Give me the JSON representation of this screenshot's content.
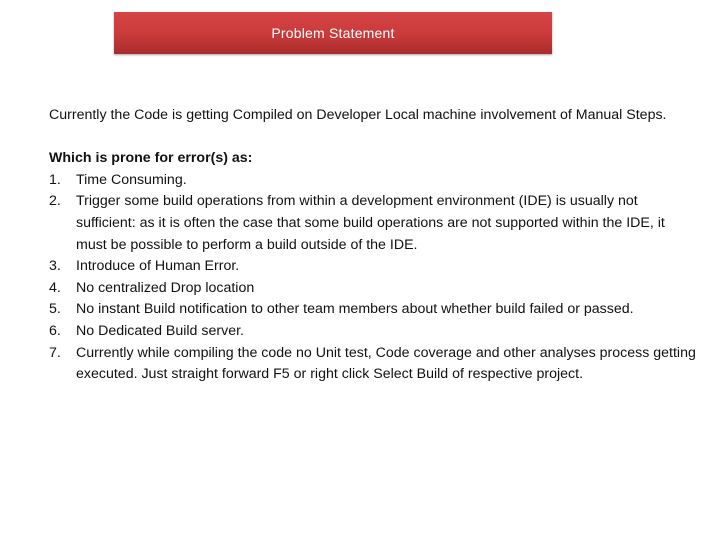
{
  "header": {
    "title": "Problem Statement",
    "color": "#c93a3a"
  },
  "intro": "Currently the Code is getting Compiled on Developer Local machine involvement of Manual Steps.",
  "list_heading": "Which is prone for error(s) as:",
  "items": [
    {
      "num": "1.",
      "text": "Time Consuming."
    },
    {
      "num": "2.",
      "text": "Trigger some build operations from within a  development environment (IDE) is usually not sufficient: as it is often the case that some build operations are not supported  within the IDE, it must be possible to perform a build outside of the IDE."
    },
    {
      "num": "3.",
      "text": "Introduce of Human Error."
    },
    {
      "num": "4.",
      "text": "No centralized Drop location"
    },
    {
      "num": "5.",
      "text": "No instant Build notification to other team members about whether build failed or passed."
    },
    {
      "num": "6.",
      "text": "No Dedicated Build server."
    },
    {
      "num": "7.",
      "text": "Currently while compiling the code no Unit test, Code coverage  and other analyses process getting executed. Just straight forward F5 or right click Select Build of respective project."
    }
  ]
}
